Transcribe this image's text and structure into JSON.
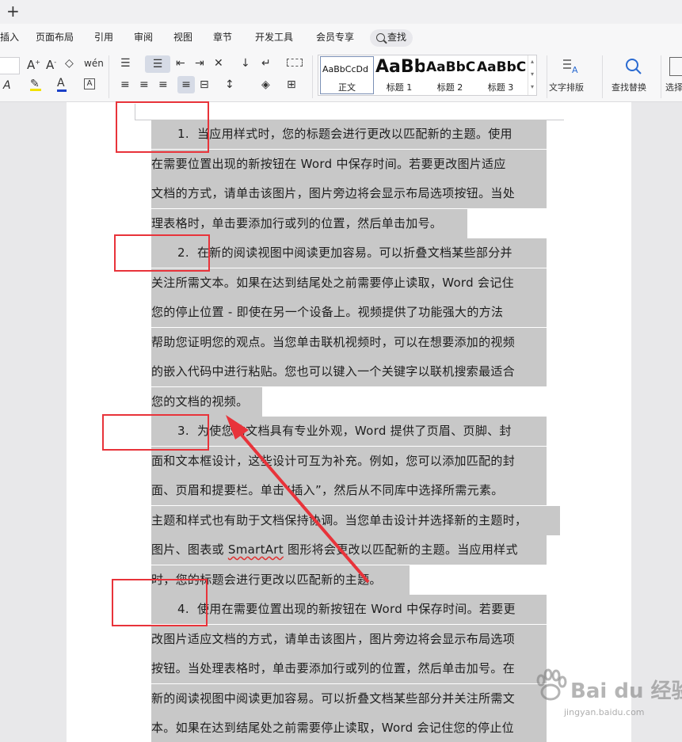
{
  "tabstrip": {
    "new_tab": "+"
  },
  "menu": {
    "items": [
      "插入",
      "页面布局",
      "引用",
      "审阅",
      "视图",
      "章节",
      "开发工具",
      "会员专享"
    ],
    "search": "查找"
  },
  "ribbon": {
    "styles": [
      {
        "sample": "AaBbCcDd",
        "caption": "正文"
      },
      {
        "sample": "AaBb",
        "caption": "标题 1"
      },
      {
        "sample": "AaBbC",
        "caption": "标题 2"
      },
      {
        "sample": "AaBbC",
        "caption": "标题 3"
      }
    ],
    "text_layout": "文字排版",
    "find_replace": "查找替换",
    "select": "选择"
  },
  "document": {
    "lines": [
      {
        "num": "1.",
        "text": "当应用样式时，您的标题会进行更改以匹配新的主题。使用"
      },
      {
        "text": "在需要位置出现的新按钮在 Word 中保存时间。若要更改图片适应"
      },
      {
        "text": "文档的方式，请单击该图片，图片旁边将会显示布局选项按钮。当处"
      },
      {
        "text": "理表格时，单击要添加行或列的位置，然后单击加号。"
      },
      {
        "num": "2.",
        "text": "在新的阅读视图中阅读更加容易。可以折叠文档某些部分并"
      },
      {
        "text": "关注所需文本。如果在达到结尾处之前需要停止读取，Word 会记住"
      },
      {
        "text": "您的停止位置 - 即使在另一个设备上。视频提供了功能强大的方法"
      },
      {
        "text": "帮助您证明您的观点。当您单击联机视频时，可以在想要添加的视频"
      },
      {
        "text": "的嵌入代码中进行粘贴。您也可以键入一个关键字以联机搜索最适合"
      },
      {
        "text": "您的文档的视频。"
      },
      {
        "num": "3.",
        "text": "为使您的文档具有专业外观，Word 提供了页眉、页脚、封"
      },
      {
        "text": "面和文本框设计，这些设计可互为补充。例如，您可以添加匹配的封"
      },
      {
        "text": "面、页眉和提要栏。单击“插入”，然后从不同库中选择所需元素。"
      },
      {
        "text": "主题和样式也有助于文档保持协调。当您单击设计并选择新的主题时，"
      },
      {
        "text": "图片、图表或 SmartArt 图形将会更改以匹配新的主题。当应用样式"
      },
      {
        "text": "时，您的标题会进行更改以匹配新的主题。"
      },
      {
        "num": "4.",
        "text": "使用在需要位置出现的新按钮在 Word 中保存时间。若要更"
      },
      {
        "text": "改图片适应文档的方式，请单击该图片，图片旁边将会显示布局选项"
      },
      {
        "text": "按钮。当处理表格时，单击要添加行或列的位置，然后单击加号。在"
      },
      {
        "text": "新的阅读视图中阅读更加容易。可以折叠文档某些部分并关注所需文"
      },
      {
        "text": "本。如果在达到结尾处之前需要停止读取，Word 会记住您的停止位"
      }
    ]
  },
  "annotation": {
    "color": "#e8333a"
  },
  "watermark": {
    "main": "Bai du 经验",
    "sub": "jingyan.baidu.com"
  }
}
